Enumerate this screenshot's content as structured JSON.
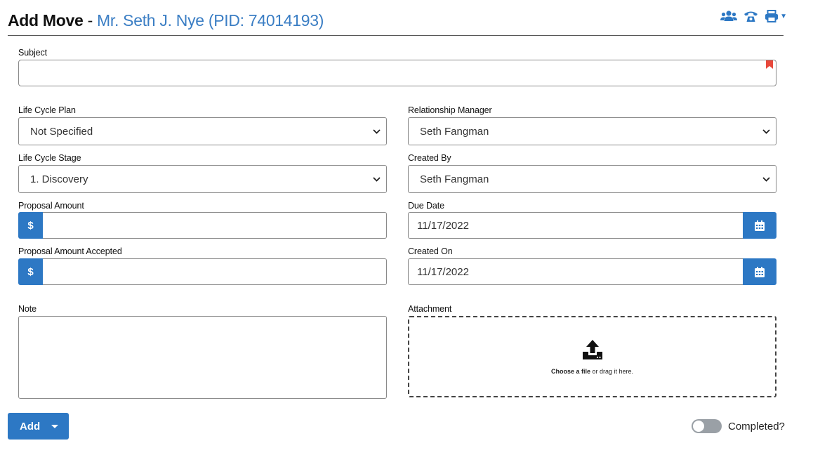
{
  "header": {
    "title": "Add Move",
    "separator": " - ",
    "person": "Mr. Seth J. Nye (PID: 74014193)",
    "icons": [
      "users-icon",
      "phone-icon",
      "print-icon"
    ]
  },
  "form": {
    "subject": {
      "label": "Subject",
      "value": ""
    },
    "life_cycle_plan": {
      "label": "Life Cycle Plan",
      "value": "Not Specified"
    },
    "relationship_manager": {
      "label": "Relationship Manager",
      "value": "Seth Fangman"
    },
    "life_cycle_stage": {
      "label": "Life Cycle Stage",
      "value": "1. Discovery"
    },
    "created_by": {
      "label": "Created By",
      "value": "Seth Fangman"
    },
    "proposal_amount": {
      "label": "Proposal Amount",
      "prefix": "$",
      "value": ""
    },
    "due_date": {
      "label": "Due Date",
      "value": "11/17/2022"
    },
    "proposal_amount_accepted": {
      "label": "Proposal Amount Accepted",
      "prefix": "$",
      "value": ""
    },
    "created_on": {
      "label": "Created On",
      "value": "11/17/2022"
    },
    "note": {
      "label": "Note",
      "value": ""
    },
    "attachment": {
      "label": "Attachment",
      "choose": "Choose a file",
      "drag": " or drag it here."
    }
  },
  "footer": {
    "add_label": "Add",
    "completed_label": "Completed?",
    "completed": false
  },
  "colors": {
    "accent": "#2d78c4",
    "person_link": "#3b7ec4",
    "required_flag": "#e8483b"
  }
}
